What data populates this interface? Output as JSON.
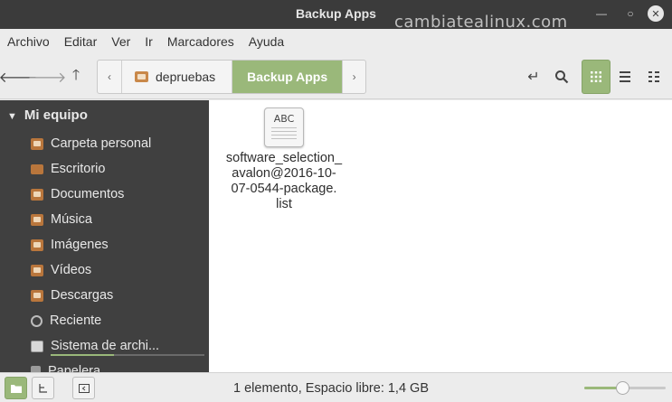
{
  "window": {
    "title": "Backup Apps",
    "watermark": "cambiatealinux.com"
  },
  "menu": [
    "Archivo",
    "Editar",
    "Ver",
    "Ir",
    "Marcadores",
    "Ayuda"
  ],
  "toolbar": {
    "path": [
      "depruebas",
      "Backup Apps"
    ]
  },
  "sidebar": {
    "section": "Mi equipo",
    "items": [
      {
        "label": "Carpeta personal",
        "icon": "home-folder-icon"
      },
      {
        "label": "Escritorio",
        "icon": "desktop-icon"
      },
      {
        "label": "Documentos",
        "icon": "documents-folder-icon"
      },
      {
        "label": "Música",
        "icon": "music-folder-icon"
      },
      {
        "label": "Imágenes",
        "icon": "pictures-folder-icon"
      },
      {
        "label": "Vídeos",
        "icon": "videos-folder-icon"
      },
      {
        "label": "Descargas",
        "icon": "downloads-folder-icon"
      },
      {
        "label": "Reciente",
        "icon": "recent-icon"
      },
      {
        "label": "Sistema de archi...",
        "icon": "drive-icon"
      },
      {
        "label": "Papelera",
        "icon": "trash-icon"
      }
    ],
    "filesystem_usage": 0.41
  },
  "files": [
    {
      "name_lines": [
        "software_selection_",
        "avalon@2016-10-",
        "07-0544-package.",
        "list"
      ],
      "icon_text": "ABC"
    }
  ],
  "status": {
    "text": "1 elemento, Espacio libre: 1,4 GB",
    "zoom_level": 0.48
  },
  "colors": {
    "accent": "#9ab87a",
    "sidebar_bg": "#404040",
    "titlebar_bg": "#3b3b3b"
  }
}
